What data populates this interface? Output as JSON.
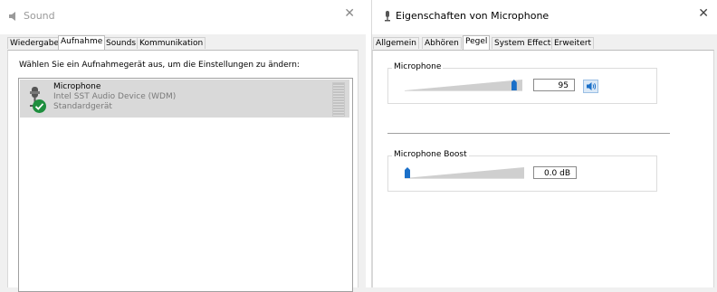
{
  "sound_window": {
    "title": "Sound",
    "tabs": [
      {
        "label": "Wiedergabe"
      },
      {
        "label": "Aufnahme"
      },
      {
        "label": "Sounds"
      },
      {
        "label": "Kommunikation"
      }
    ],
    "active_tab": "Aufnahme",
    "instruction": "Wählen Sie ein Aufnahmegerät aus, um die Einstellungen zu ändern:",
    "device": {
      "name": "Microphone",
      "driver": "Intel SST Audio Device (WDM)",
      "status": "Standardgerät",
      "default_badge_color": "#1e8e3e",
      "icon": "microphone-icon"
    }
  },
  "props_window": {
    "title": "Eigenschaften von Microphone",
    "tabs": [
      {
        "label": "Allgemein"
      },
      {
        "label": "Abhören"
      },
      {
        "label": "Pegel"
      },
      {
        "label": "System Effects"
      },
      {
        "label": "Erweitert"
      }
    ],
    "active_tab": "Pegel",
    "microphone": {
      "label": "Microphone",
      "value": "95",
      "level_fraction": 0.95,
      "speaker_icon": "speaker-icon"
    },
    "boost": {
      "label": "Microphone Boost",
      "value": "0.0 dB",
      "level_fraction": 0.0
    },
    "accent_color": "#1a6fc8"
  }
}
